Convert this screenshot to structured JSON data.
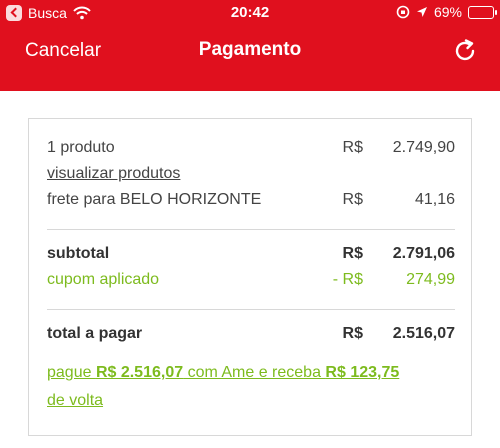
{
  "status_bar": {
    "carrier": "Busca",
    "time": "20:42",
    "battery": "69%",
    "battery_level": 0.69
  },
  "nav": {
    "cancel_label": "Cancelar",
    "title": "Pagamento",
    "refresh_icon": "refresh-icon"
  },
  "summary": {
    "items": {
      "label": "1 produto",
      "currency": "R$",
      "value": "2.749,90"
    },
    "view_products_label": "visualizar produtos",
    "shipping": {
      "label": "frete para BELO HORIZONTE",
      "currency": "R$",
      "value": "41,16"
    },
    "subtotal": {
      "label": "subtotal",
      "currency": "R$",
      "value": "2.791,06"
    },
    "coupon": {
      "label": "cupom aplicado",
      "currency": "- R$",
      "value": "274,99"
    },
    "total": {
      "label": "total a pagar",
      "currency": "R$",
      "value": "2.516,07"
    },
    "promo": {
      "part1": "pague ",
      "amount_pay": "R$ 2.516,07",
      "part2": " com Ame e receba ",
      "amount_back": "R$ 123,75",
      "part3": " de volta"
    }
  },
  "colors": {
    "brand_red": "#e0101e",
    "accent_green": "#7dbb1e"
  }
}
